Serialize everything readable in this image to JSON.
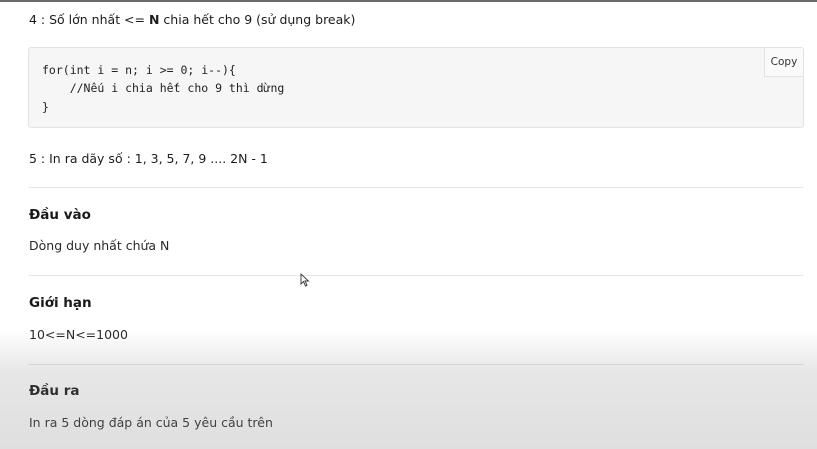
{
  "problem": {
    "prefix": "4 : Số lớn nhất <= ",
    "bold_n": "N",
    "suffix": " chia hết cho 9 (sử dụng break)"
  },
  "code": {
    "line1": "for(int i = n; i >= 0; i--){",
    "line2": "    //Nếu i chia hết cho 9 thì dừng",
    "line3": "}",
    "copy_label": "Copy"
  },
  "sequence_line": "5 : In ra dãy số : 1, 3, 5, 7, 9 .... 2N - 1",
  "sections": {
    "input": {
      "heading": "Đầu vào",
      "text": "Dòng duy nhất chứa N"
    },
    "limits": {
      "heading": "Giới hạn",
      "text": "10<=N<=1000"
    },
    "output": {
      "heading": "Đầu ra",
      "text": "In ra 5 dòng đáp án của 5 yêu cầu trên"
    }
  }
}
